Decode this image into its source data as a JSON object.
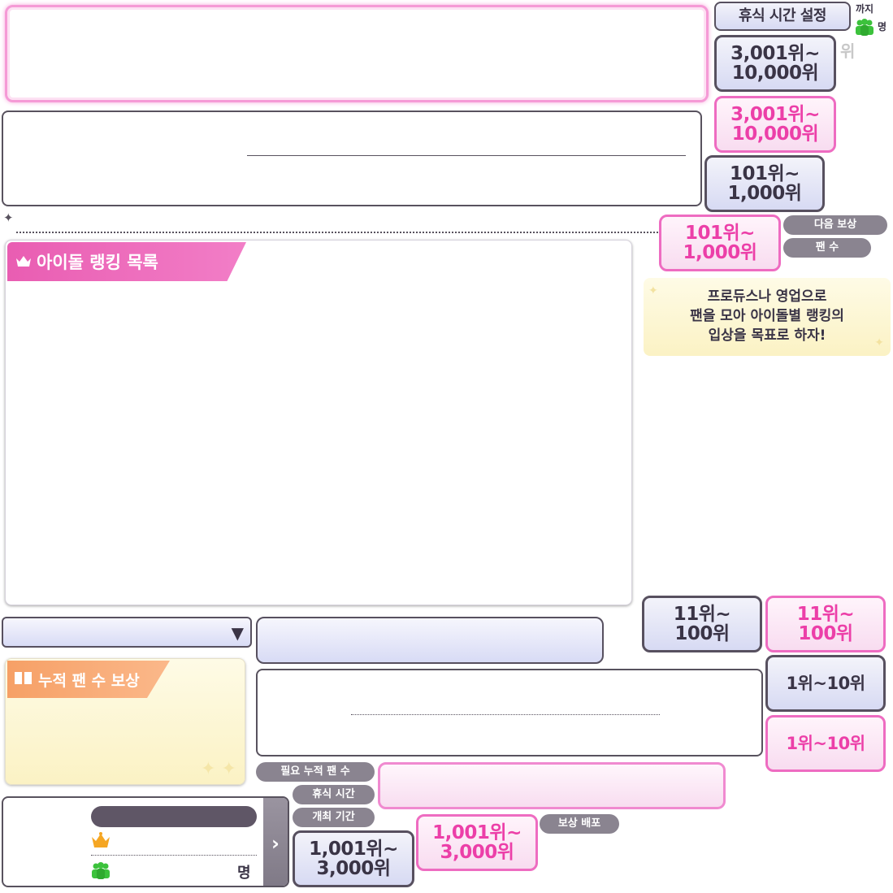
{
  "header": {
    "rest_time_setting": "휴식 시간 설정",
    "until": "까지",
    "people_unit": "명",
    "rank_unit": "위"
  },
  "ranks": {
    "r3001_grey": [
      "3,001위~",
      "10,000위"
    ],
    "r3001_pink": [
      "3,001위~",
      "10,000위"
    ],
    "r101_grey": [
      "101위~",
      "1,000위"
    ],
    "r101_pink": [
      "101위~",
      "1,000위"
    ],
    "r11_grey": [
      "11위~",
      "100위"
    ],
    "r11_pink": [
      "11위~",
      "100위"
    ],
    "r1_grey": "1위~10위",
    "r1_pink": "1위~10위",
    "r1001_grey": [
      "1,001위~",
      "3,000위"
    ],
    "r1001_pink": [
      "1,001위~",
      "3,000위"
    ]
  },
  "labels": {
    "next_reward": "다음 보상",
    "fan_count": "팬 수",
    "required_fans": "필요 누적 팬 수",
    "rest_time": "휴식 시간",
    "event_period": "개최 기간",
    "reward_distribution": "보상 배포"
  },
  "sections": {
    "idol_ranking_list": "아이돌 랭킹 목록",
    "cumulative_fan_reward": "누적 팬 수 보상"
  },
  "hint": {
    "line1": "프로듀스나 영업으로",
    "line2": "팬을 모아 아이돌별 랭킹의",
    "line3": "입상을 목표로 하자!"
  },
  "bottom_card": {
    "people_unit": "명"
  },
  "colors": {
    "pink": "#ec3fa8",
    "dark": "#57505f",
    "grey_pill": "#8a8490",
    "orange_tab": "#f6a066",
    "gold_crown": "#f5a623",
    "green_people": "#3cc23c"
  }
}
